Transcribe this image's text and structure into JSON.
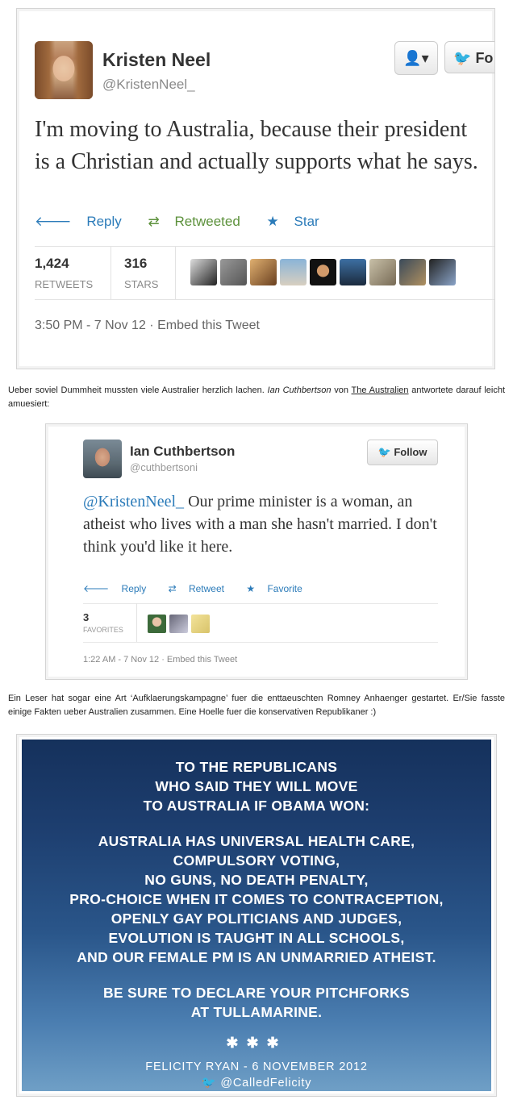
{
  "tweet1": {
    "name": "Kristen Neel",
    "handle": "@KristenNeel_",
    "user_button": "👤▾",
    "follow_label": "Fo",
    "text": "I'm moving to Australia, because their president is a Christian and actually supports what he says.",
    "reply": "Reply",
    "retweeted": "Retweeted",
    "star": "Star",
    "retweets_count": "1,424",
    "retweets_label": "RETWEETS",
    "stars_count": "316",
    "stars_label": "STARS",
    "timestamp": "3:50 PM - 7 Nov 12 · Embed this Tweet"
  },
  "para1": {
    "text_before": "Ueber soviel Dummheit mussten viele Australier herzlich lachen. ",
    "author": "Ian Cuthbertson",
    "text_middle": " von ",
    "source_link": "The Australien",
    "text_after": " antwortete darauf leicht amuesiert:"
  },
  "tweet2": {
    "name": "Ian Cuthbertson",
    "handle": "@cuthbertsoni",
    "follow_label": "Follow",
    "mention": "@KristenNeel_",
    "text": " Our prime minister is a woman, an atheist who lives with a man she hasn't married. I don't think you'd like it here.",
    "reply": "Reply",
    "retweet": "Retweet",
    "favorite": "Favorite",
    "favorites_count": "3",
    "favorites_label": "FAVORITES",
    "timestamp": "1:22 AM - 7 Nov 12 · Embed this Tweet"
  },
  "para2": {
    "text": "Ein Leser hat sogar eine Art ‘Aufklaerungskampagne’ fuer die enttaeuschten Romney Anhaenger gestartet. Er/Sie fasste einige Fakten ueber Australien zusammen. Eine Hoelle fuer die konservativen Republikaner :)"
  },
  "poster": {
    "heading": [
      "TO THE REPUBLICANS",
      "WHO SAID THEY WILL MOVE",
      "TO AUSTRALIA IF OBAMA WON:"
    ],
    "facts": [
      "AUSTRALIA HAS UNIVERSAL HEALTH CARE,",
      "COMPULSORY VOTING,",
      "NO GUNS, NO DEATH PENALTY,",
      "PRO-CHOICE WHEN IT COMES TO CONTRACEPTION,",
      "OPENLY GAY POLITICIANS AND JUDGES,",
      "EVOLUTION IS TAUGHT IN ALL SCHOOLS,",
      "AND OUR FEMALE PM IS AN UNMARRIED ATHEIST."
    ],
    "closing": [
      "BE SURE TO DECLARE YOUR PITCHFORKS",
      "AT TULLAMARINE."
    ],
    "stars": "✱✱✱",
    "credit": "FELICITY RYAN - 6 NOVEMBER 2012",
    "twitter_handle": "@CalledFelicity"
  },
  "colors": {
    "link_blue": "#2b7bb9",
    "retweet_green": "#5c913b",
    "twitter_bird": "#2aa3d8"
  }
}
